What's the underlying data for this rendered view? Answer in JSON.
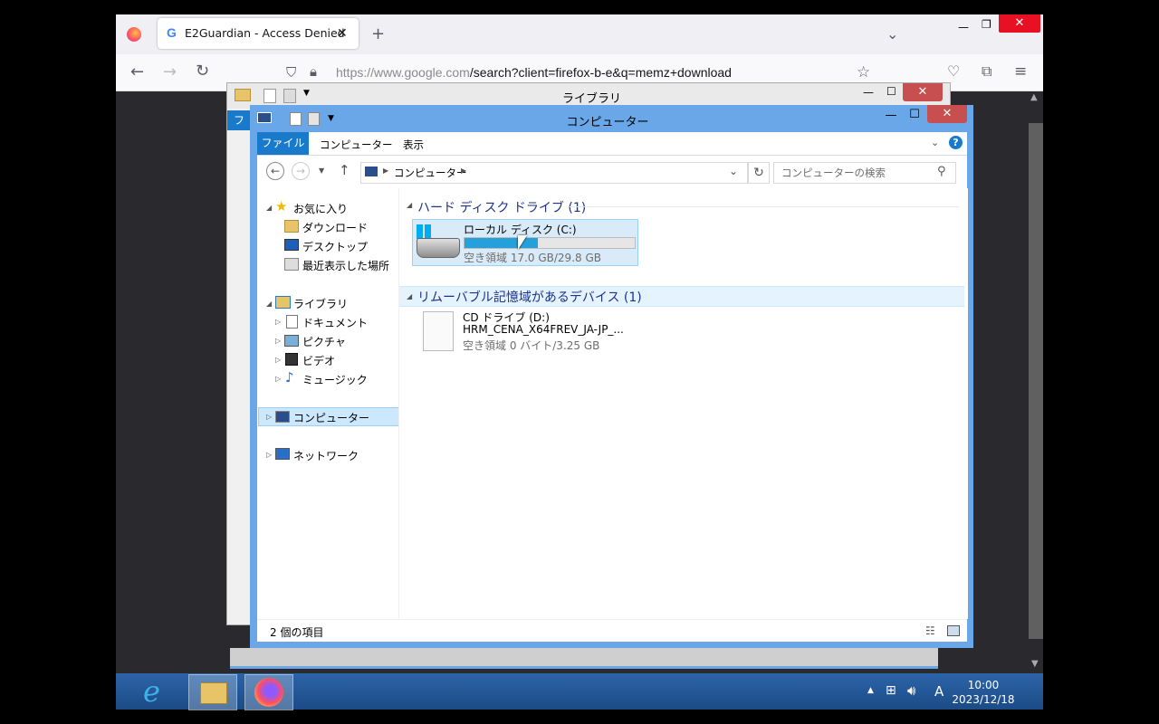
{
  "browser": {
    "tab_title": "E2Guardian - Access Denied",
    "url_host": "https://www.google.com",
    "url_path": "/search?client=firefox-b-e&q=memz+download"
  },
  "back_window": {
    "title": "ライブラリ",
    "partial_label": "フ"
  },
  "explorer": {
    "title": "コンピューター",
    "ribbon_tabs": [
      "ファイル",
      "コンピューター",
      "表示"
    ],
    "breadcrumb": "コンピューター",
    "search_placeholder": "コンピューターの検索",
    "nav": {
      "favorites": "お気に入り",
      "downloads": "ダウンロード",
      "desktop": "デスクトップ",
      "recent": "最近表示した場所",
      "libraries": "ライブラリ",
      "documents": "ドキュメント",
      "pictures": "ピクチャ",
      "videos": "ビデオ",
      "music": "ミュージック",
      "computer": "コンピューター",
      "network": "ネットワーク"
    },
    "groups": {
      "hdd": "ハード ディスク ドライブ (1)",
      "removable": "リムーバブル記憶域があるデバイス (1)"
    },
    "drives": {
      "c": {
        "name": "ローカル ディスク (C:)",
        "free": "空き領域 17.0 GB/29.8 GB",
        "used_fraction": 0.43
      },
      "d": {
        "name": "CD ドライブ (D:)",
        "label": "HRM_CENA_X64FREV_JA-JP_...",
        "free": "空き領域 0 バイト/3.25 GB"
      }
    },
    "status": "2 個の項目"
  },
  "taskbar": {
    "time": "10:00",
    "date": "2023/12/18",
    "ime": "A"
  }
}
